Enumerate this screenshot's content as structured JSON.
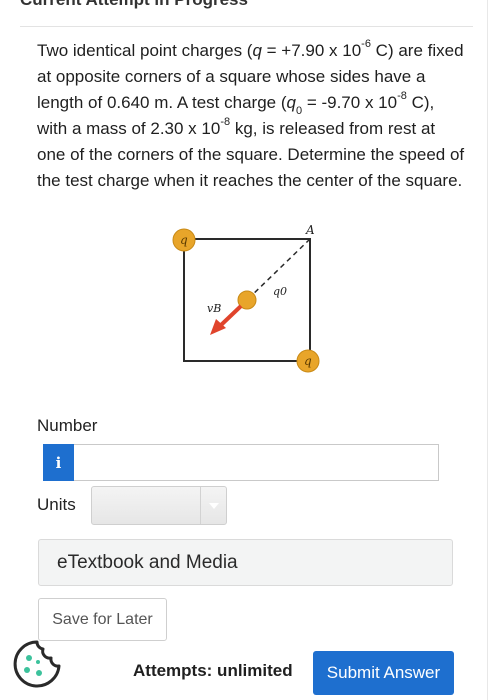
{
  "header": {
    "title": "Current Attempt in Progress"
  },
  "problem": {
    "p1": "Two identical point charges (",
    "q_sym": "q",
    "p2": " = +7.90 x 10",
    "exp1": "-6",
    "p3": " C) are fixed at opposite corners of a square whose sides have a length of 0.640 m. A test charge (",
    "q0_sym": "q",
    "q0_sub": "0",
    "p4": " = -9.70 x 10",
    "exp2": "-8",
    "p5": " C), with a mass of 2.30 x 10",
    "exp3": "-8",
    "p6": " kg, is released from rest at one of the corners of the square. Determine the speed of the test charge when it reaches the center of the square."
  },
  "figure": {
    "corner_label": "A",
    "charge_label": "q",
    "test_label": "q0",
    "velocity_label": "vB",
    "charge_color": "#e8a52a",
    "arrow_color": "#e0442c"
  },
  "answer": {
    "number_label": "Number",
    "info_icon_text": "i",
    "number_value": "",
    "units_label": "Units",
    "units_selected": ""
  },
  "resources": {
    "etextbook_label": "eTextbook and Media"
  },
  "actions": {
    "save_label": "Save for Later",
    "attempts_text": "Attempts: unlimited",
    "submit_label": "Submit Answer"
  },
  "colors": {
    "accent": "#1e6fcf"
  }
}
